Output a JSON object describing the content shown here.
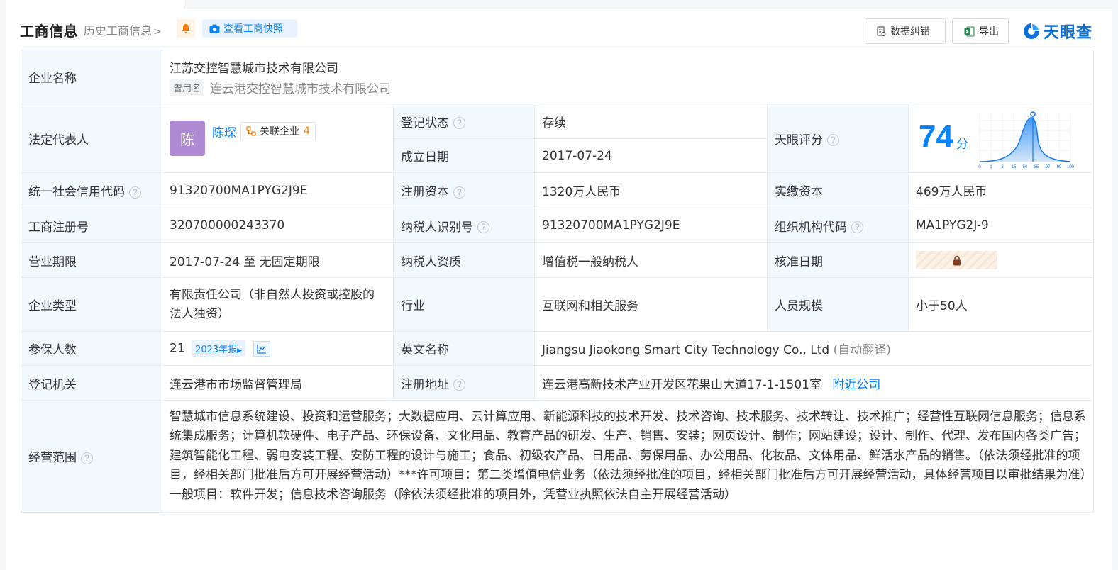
{
  "header": {
    "title": "工商信息",
    "history_link": "历史工商信息",
    "snapshot_label": "查看工商快照",
    "correct_label": "数据纠错",
    "export_label": "导出",
    "logo_text": "天眼查"
  },
  "company": {
    "name_label": "企业名称",
    "name": "江苏交控智慧城市技术有限公司",
    "former_tag": "曾用名",
    "former_name": "连云港交控智慧城市技术有限公司",
    "legal_label": "法定代表人",
    "legal_avatar": "陈",
    "legal_name": "陈琛",
    "related_label": "关联企业",
    "related_count": "4",
    "status_label": "登记状态",
    "status": "存续",
    "founded_label": "成立日期",
    "founded": "2017-07-24",
    "score_label": "天眼评分",
    "score": "74",
    "score_unit": "分",
    "score_axis": [
      "0",
      "1",
      "3",
      "15",
      "50",
      "85",
      "97",
      "99",
      "100"
    ],
    "credit_label": "统一社会信用代码",
    "credit_code": "91320700MA1PYG2J9E",
    "capital_label": "注册资本",
    "capital": "1320万人民币",
    "paid_label": "实缴资本",
    "paid": "469万人民币",
    "reg_no_label": "工商注册号",
    "reg_no": "320700000243370",
    "taxpayer_id_label": "纳税人识别号",
    "taxpayer_id": "91320700MA1PYG2J9E",
    "org_code_label": "组织机构代码",
    "org_code": "MA1PYG2J-9",
    "term_label": "营业期限",
    "term": "2017-07-24 至 无固定期限",
    "taxpayer_type_label": "纳税人资质",
    "taxpayer_type": "增值税一般纳税人",
    "approve_label": "核准日期",
    "type_label": "企业类型",
    "type": "有限责任公司（非自然人投资或控股的法人独资）",
    "industry_label": "行业",
    "industry": "互联网和相关服务",
    "staff_label": "人员规模",
    "staff": "小于50人",
    "insured_label": "参保人数",
    "insured": "21",
    "annual_report": "2023年报",
    "english_label": "英文名称",
    "english_name": "Jiangsu Jiaokong Smart City Technology Co., Ltd",
    "english_note": "(自动翻译)",
    "authority_label": "登记机关",
    "authority": "连云港市市场监督管理局",
    "address_label": "注册地址",
    "address": "连云港高新技术产业开发区花果山大道17-1-1501室",
    "nearby": "附近公司",
    "scope_label": "经营范围",
    "scope": "智慧城市信息系统建设、投资和运营服务；大数据应用、云计算应用、新能源科技的技术开发、技术咨询、技术服务、技术转让、技术推广；经营性互联网信息服务；信息系统集成服务；计算机软硬件、电子产品、环保设备、文化用品、教育产品的研发、生产、销售、安装；网页设计、制作；网站建设；设计、制作、代理、发布国内各类广告；建筑智能化工程、弱电安装工程、安防工程的设计与施工；食品、初级农产品、日用品、劳保用品、办公用品、化妆品、文体用品、鲜活水产品的销售。（依法须经批准的项目，经相关部门批准后方可开展经营活动）***许可项目：第二类增值电信业务（依法须经批准的项目，经相关部门批准后方可开展经营活动，具体经营项目以审批结果为准）一般项目：软件开发；信息技术咨询服务（除依法须经批准的项目外，凭营业执照依法自主开展经营活动）"
  },
  "colors": {
    "brand": "#0084ff",
    "label_bg": "#f2f9fc",
    "status_green": "#1fa855",
    "count_orange": "#ff7a00",
    "avatar_purple": "#b08ad3"
  },
  "icons": [
    "bell-icon",
    "camera-icon",
    "document-icon",
    "excel-icon",
    "tianyancha-logo-icon",
    "help-icon",
    "related-company-icon",
    "lock-icon",
    "trend-chart-icon"
  ]
}
